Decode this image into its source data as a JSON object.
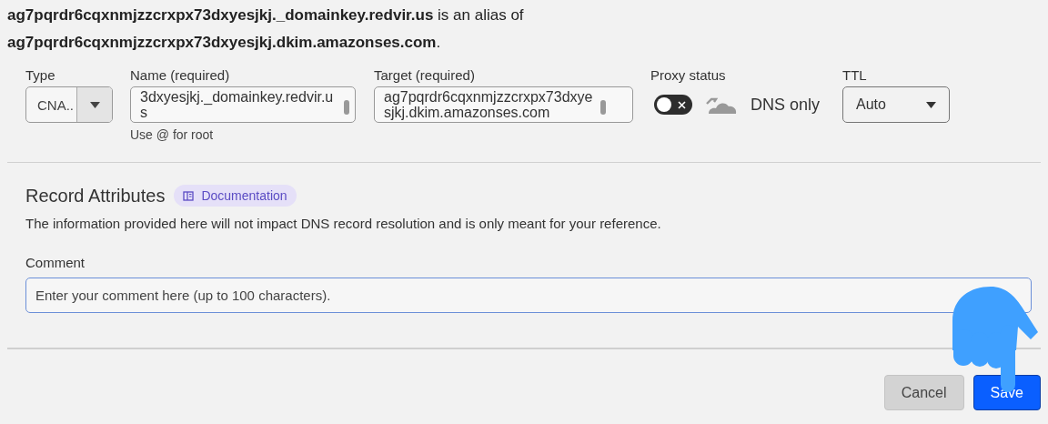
{
  "alias_note": "**ag7pqrdr6cqxnmjzzcrxpx73dxyesjkj._domainkey.redvir.us** is an alias of **ag7pqrdr6cqxnmjzzcrxpx73dxyesjkj.dkim.amazonses.com**.",
  "record": {
    "type": {
      "label": "Type",
      "value": "CNA.."
    },
    "name": {
      "label": "Name (required)",
      "value": "3dxyesjkj._domainkey.redvir.us",
      "hint": "Use @ for root"
    },
    "target": {
      "label": "Target (required)",
      "value": "ag7pqrdr6cqxnmjzzcrxpx73dxyesjkj.dkim.amazonses.com"
    },
    "proxy": {
      "label": "Proxy status",
      "on": false,
      "status_text": "DNS only"
    },
    "ttl": {
      "label": "TTL",
      "value": "Auto"
    }
  },
  "attributes": {
    "title": "Record Attributes",
    "doc_link": "Documentation",
    "description": "The information provided here will not impact DNS record resolution and is only meant for your reference.",
    "comment_label": "Comment",
    "comment_placeholder": "Enter your comment here (up to 100 characters)."
  },
  "buttons": [
    {
      "label": "Cancel",
      "kind": "secondary"
    },
    {
      "label": "Save",
      "kind": "primary"
    }
  ]
}
